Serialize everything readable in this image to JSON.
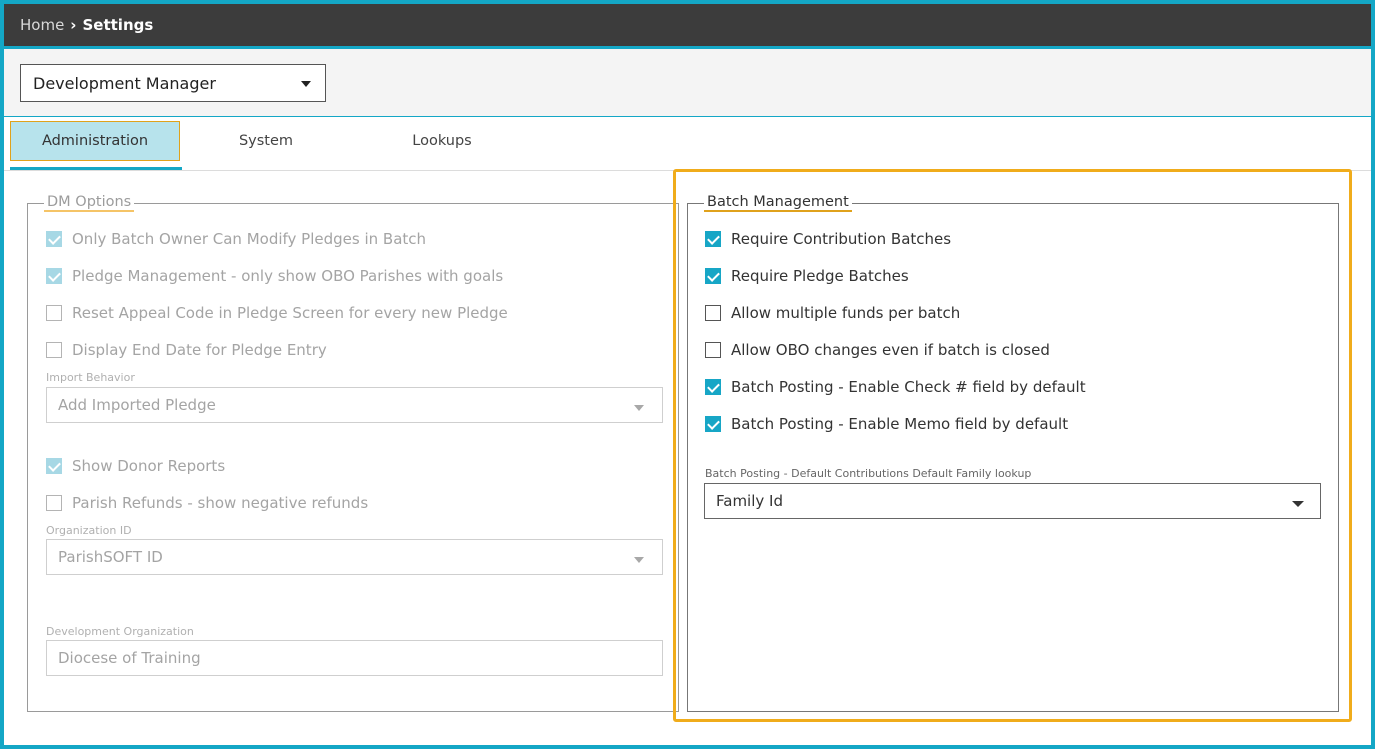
{
  "breadcrumb": {
    "home": "Home",
    "current": "Settings"
  },
  "role_select": {
    "value": "Development Manager"
  },
  "tabs": [
    {
      "label": "Administration",
      "active": true
    },
    {
      "label": "System",
      "active": false
    },
    {
      "label": "Lookups",
      "active": false
    }
  ],
  "dm_options": {
    "legend": "DM Options",
    "options": [
      {
        "label": "Only Batch Owner Can Modify Pledges in Batch",
        "checked": true
      },
      {
        "label": "Pledge Management - only show OBO Parishes with goals",
        "checked": true
      },
      {
        "label": "Reset Appeal Code in Pledge Screen for every new Pledge",
        "checked": false
      },
      {
        "label": "Display End Date for Pledge Entry",
        "checked": false
      }
    ],
    "import_behavior": {
      "label": "Import Behavior",
      "value": "Add Imported Pledge"
    },
    "options2": [
      {
        "label": "Show Donor Reports",
        "checked": true
      },
      {
        "label": "Parish Refunds - show negative refunds",
        "checked": false
      }
    ],
    "organization_id": {
      "label": "Organization ID",
      "value": "ParishSOFT ID"
    },
    "development_org": {
      "label": "Development Organization",
      "value": "Diocese of Training"
    }
  },
  "batch_management": {
    "legend": "Batch Management",
    "options": [
      {
        "label": "Require Contribution Batches",
        "checked": true
      },
      {
        "label": "Require Pledge Batches",
        "checked": true
      },
      {
        "label": "Allow multiple funds per batch",
        "checked": false
      },
      {
        "label": "Allow OBO changes even if batch is closed",
        "checked": false
      },
      {
        "label": "Batch Posting - Enable Check # field by default",
        "checked": true
      },
      {
        "label": "Batch Posting - Enable Memo field by default",
        "checked": true
      }
    ],
    "family_lookup": {
      "label": "Batch Posting - Default Contributions Default Family lookup",
      "value": "Family Id"
    }
  },
  "colors": {
    "accent": "#14a7c6",
    "highlight": "#f0ac1b",
    "topbar": "#3c3c3c"
  },
  "icons": {
    "breadcrumb_separator": "chevron-right-icon",
    "dropdown": "caret-down-icon",
    "checkbox": "check-icon"
  }
}
